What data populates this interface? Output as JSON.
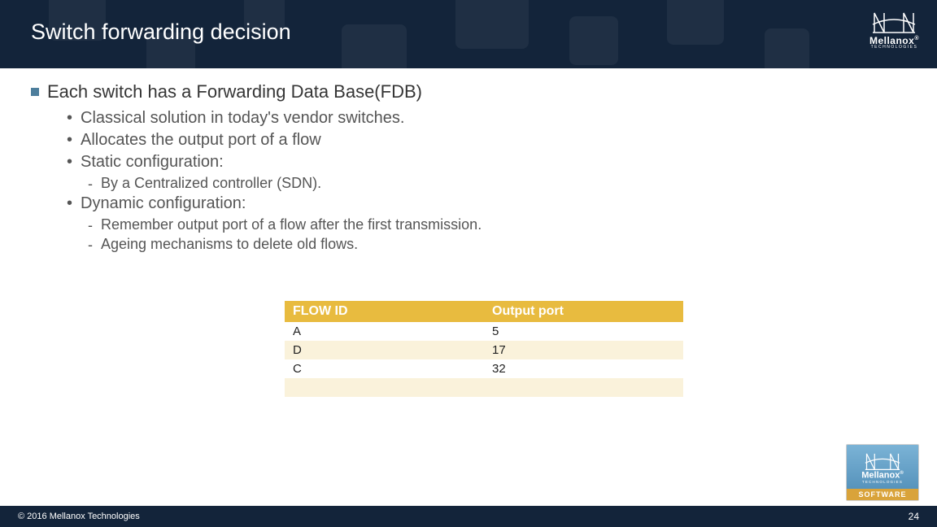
{
  "header": {
    "title": "Switch forwarding decision"
  },
  "brand": {
    "name": "Mellanox",
    "sub": "TECHNOLOGIES",
    "software": "SOFTWARE"
  },
  "content": {
    "lvl1": "Each switch has a Forwarding Data Base(FDB)",
    "b1": "Classical solution in today's vendor switches.",
    "b2": "Allocates the output port of a flow",
    "b3": "Static configuration:",
    "b3a": "By a Centralized controller (SDN).",
    "b4": "Dynamic configuration:",
    "b4a": "Remember output port of a flow after the first transmission.",
    "b4b": "Ageing mechanisms to delete old flows."
  },
  "table": {
    "headers": [
      "FLOW ID",
      "Output port"
    ],
    "rows": [
      [
        "A",
        "5"
      ],
      [
        "D",
        "17"
      ],
      [
        "C",
        "32"
      ],
      [
        "",
        ""
      ],
      [
        "",
        ""
      ]
    ]
  },
  "footer": {
    "copyright": "© 2016 Mellanox Technologies",
    "page": "24"
  }
}
